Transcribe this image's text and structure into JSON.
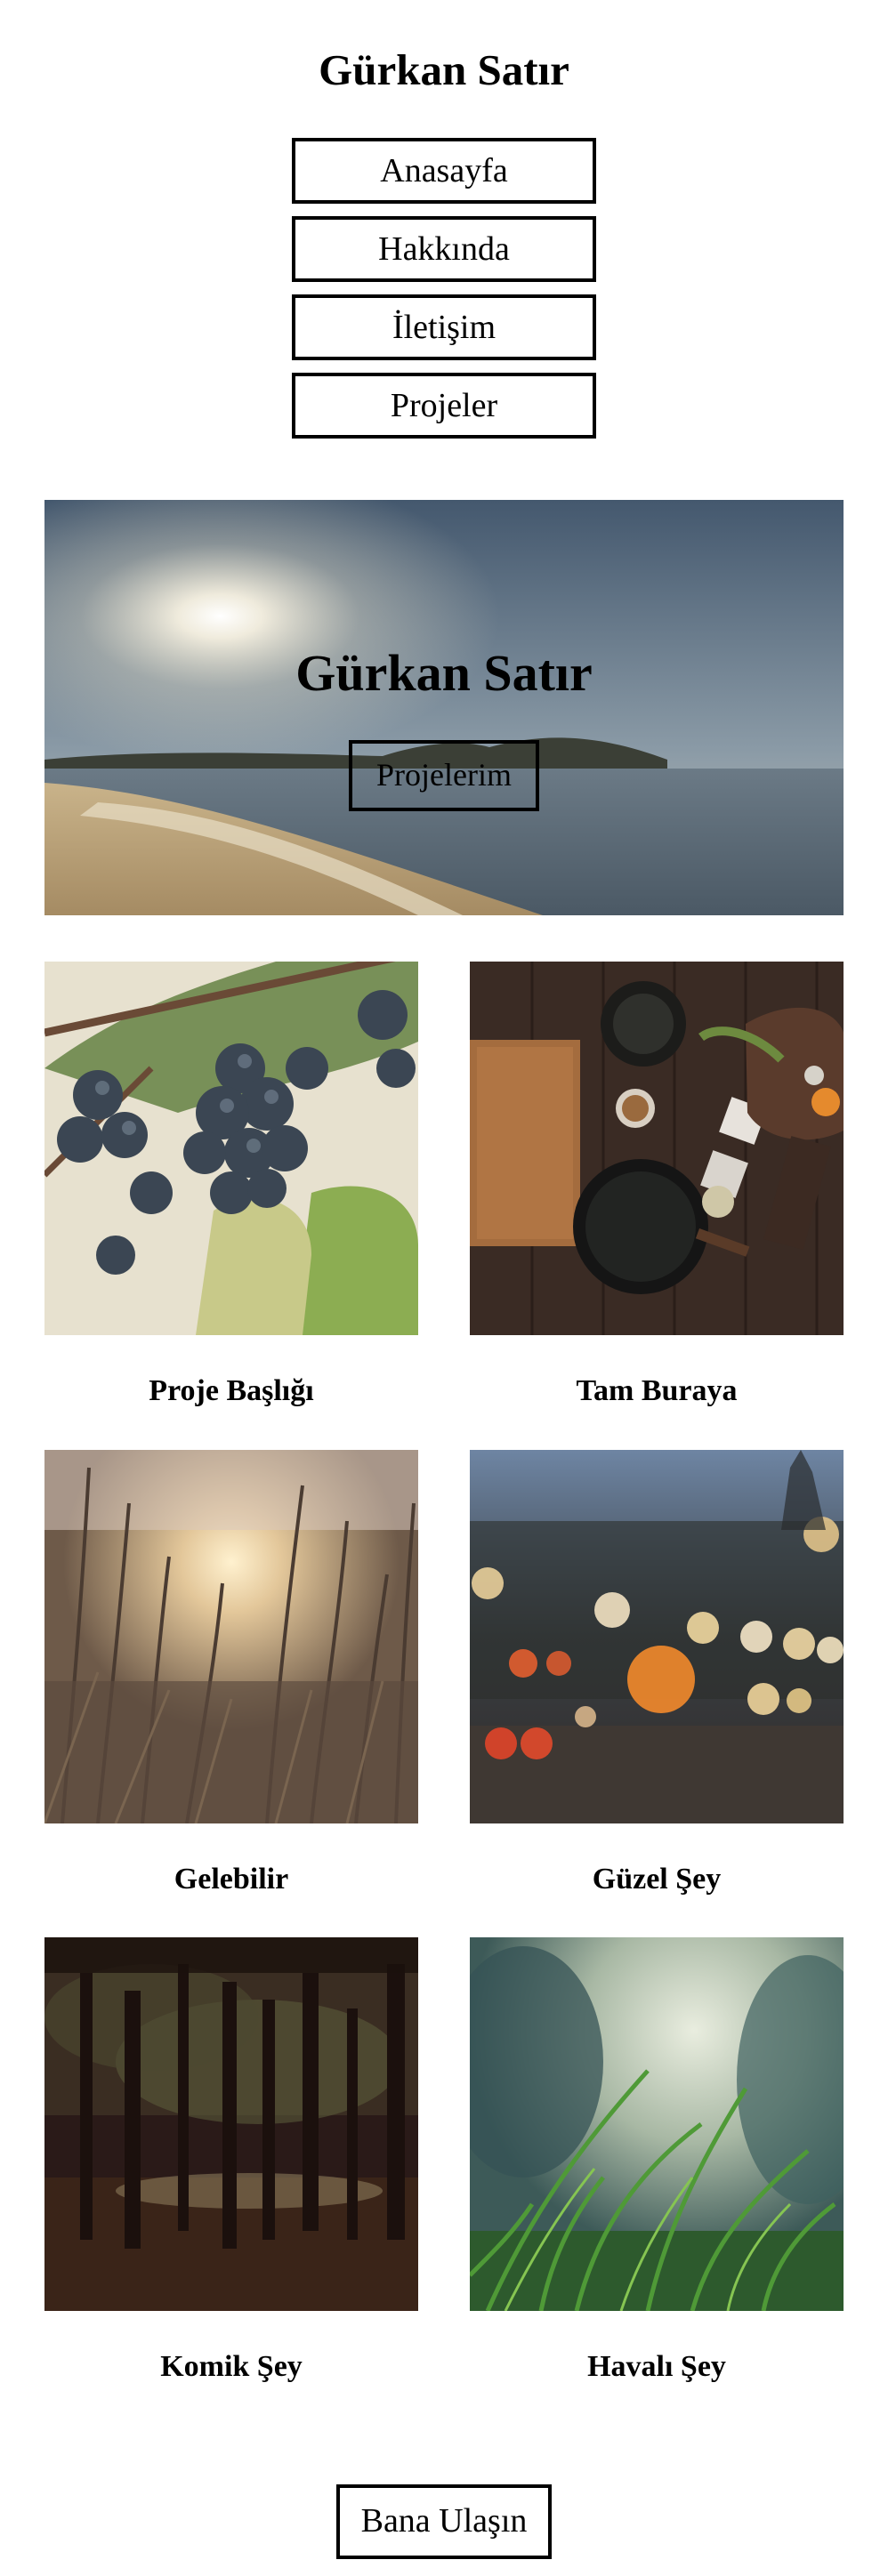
{
  "site": {
    "title": "Gürkan Satır"
  },
  "nav": {
    "items": [
      {
        "label": "Anasayfa"
      },
      {
        "label": "Hakkında"
      },
      {
        "label": "İletişim"
      },
      {
        "label": "Projeler"
      }
    ]
  },
  "hero": {
    "title": "Gürkan Satır",
    "button_label": "Projelerim"
  },
  "projects": [
    {
      "title": "Proje Başlığı",
      "image": "grapes-photo"
    },
    {
      "title": "Tam Buraya",
      "image": "kitchen-table-photo"
    },
    {
      "title": "Gelebilir",
      "image": "tall-grass-sunset-photo"
    },
    {
      "title": "Güzel Şey",
      "image": "city-bokeh-photo"
    },
    {
      "title": "Komik Şey",
      "image": "forest-trees-photo"
    },
    {
      "title": "Havalı Şey",
      "image": "grass-closeup-photo"
    }
  ],
  "footer": {
    "contact_label": "Bana Ulaşın"
  },
  "colors": {
    "border": "#000000",
    "background": "#ffffff",
    "text": "#000000"
  }
}
